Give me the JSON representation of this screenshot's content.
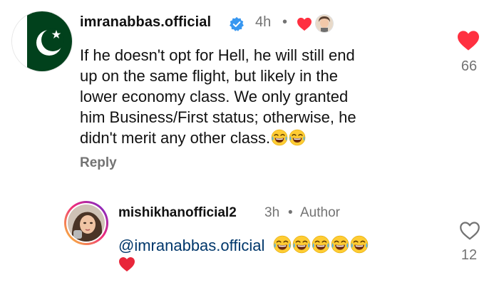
{
  "comment": {
    "username": "imranabbas.official",
    "time": "4h",
    "separator": "•",
    "text_lines": [
      "If he doesn't opt for Hell, he will still end",
      "up on the same flight, but likely in the",
      "lower economy class. We only granted",
      "him Business/First status; otherwise, he",
      "didn't merit any other class."
    ],
    "reply_label": "Reply",
    "like_count": "66",
    "liked": true,
    "icons": {
      "avatar": "pakistan-flag-avatar",
      "verified": "verified-badge-icon",
      "creator_liked": "heart-icon",
      "like": "heart-filled-icon",
      "text_emoji": "face-with-tears-of-joy"
    },
    "colors": {
      "verified": "#3897f0",
      "heart": "#ff3040",
      "flag_green": "#01411c"
    }
  },
  "reply": {
    "username": "mishikhanofficial2",
    "time": "3h",
    "separator": "•",
    "author_label": "Author",
    "mention": "@imranabbas.official",
    "like_count": "12",
    "liked": false,
    "icons": {
      "avatar": "profile-photo-avatar",
      "text_emoji": "face-with-tears-of-joy",
      "text_heart": "red-heart",
      "like": "heart-outline-icon"
    },
    "colors": {
      "mention": "#00376b",
      "muted": "#737373"
    }
  }
}
